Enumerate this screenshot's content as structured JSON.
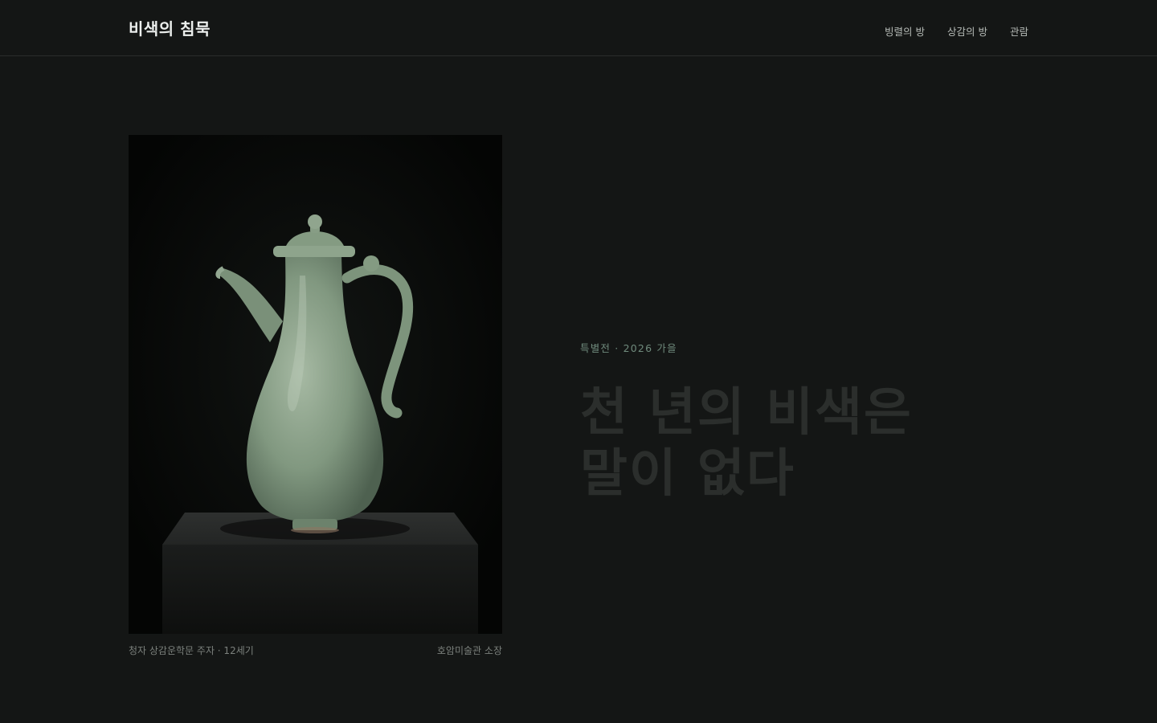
{
  "header": {
    "site_title": "비색의 침묵",
    "nav": [
      "빙렬의 방",
      "상감의 방",
      "관람"
    ]
  },
  "artwork": {
    "caption_title": "청자 상감운학문 주자 · 12세기",
    "caption_owner": "호암미술관 소장"
  },
  "hero": {
    "eyebrow": "특별전 · 2026 가을",
    "headline_line1": "천 년의 비색은",
    "headline_line2": "말이 없다"
  },
  "colors": {
    "background": "#141615",
    "celadon": "#8fa592",
    "headline": "#2b2e2c",
    "eyebrow": "#6f8a7c"
  }
}
